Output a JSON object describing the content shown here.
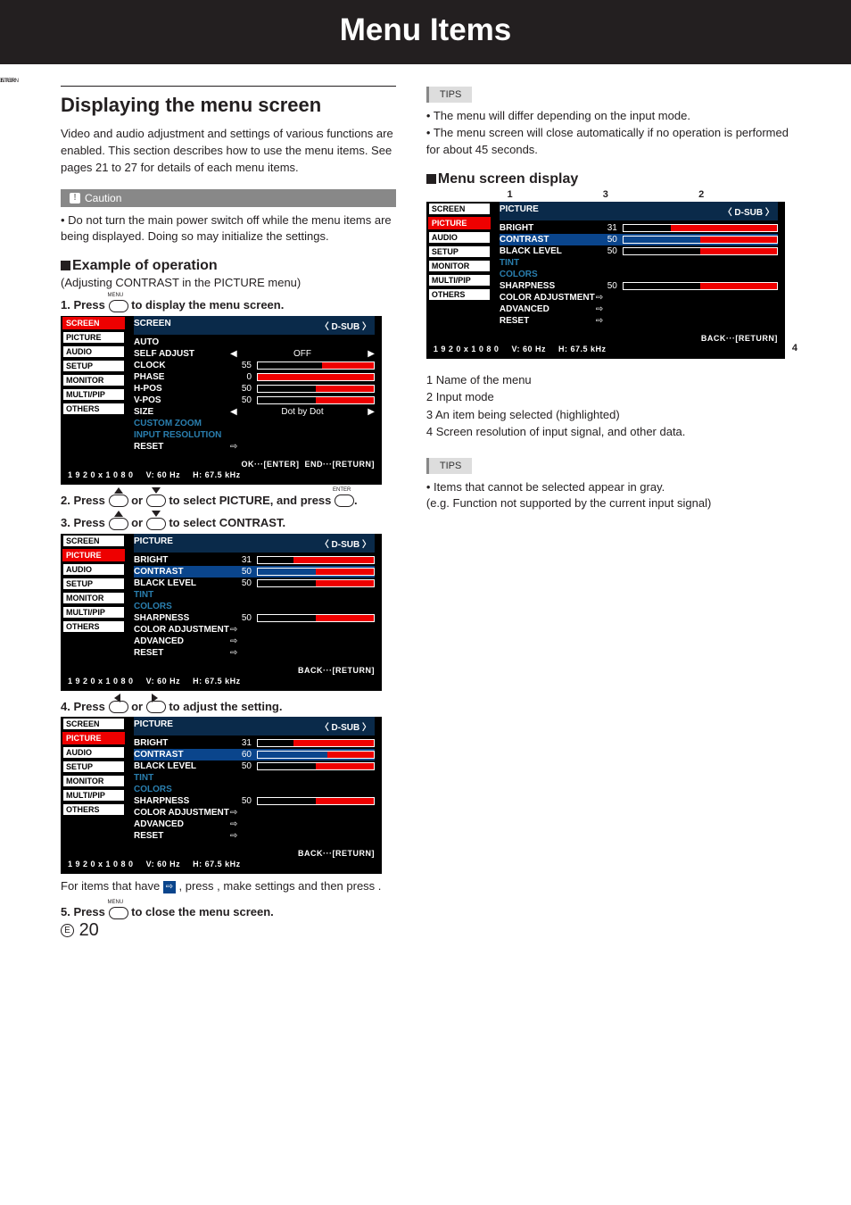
{
  "title": "Menu Items",
  "h_display": "Displaying the menu screen",
  "intro": "Video and audio adjustment and settings of various functions are enabled. This section describes how to use the menu items. See pages 21 to 27 for details of each menu items.",
  "caution_label": "Caution",
  "caution_text": "Do not turn the main power switch off while the menu items are being displayed. Doing so may initialize the settings.",
  "example_h": "Example of operation",
  "example_sub": "(Adjusting CONTRAST in the PICTURE menu)",
  "step1_a": "1.  Press ",
  "step1_b": " to display the menu screen.",
  "step2_a": "2.  Press ",
  "step2_or": " or ",
  "step2_b": " to select PICTURE, and press ",
  "step2_c": ".",
  "step3_a": "3.  Press ",
  "step3_b": " to select CONTRAST.",
  "step4_a": "4.  Press ",
  "step4_b": " to adjust the setting.",
  "after_osd_a": "For items that have ",
  "after_osd_b": " , press ",
  "after_osd_c": ", make settings and then press ",
  "after_osd_d": " .",
  "step5_a": "5.  Press ",
  "step5_b": " to close the menu screen.",
  "tips_label": "TIPS",
  "tips1": "The menu will differ depending on the input mode.",
  "tips2": "The menu screen will close automatically if no operation is performed for about 45 seconds.",
  "msd_h": "Menu screen display",
  "callouts": {
    "c1": "1",
    "c2": "2",
    "c3": "3",
    "c4": "4"
  },
  "legend1": "1   Name of the menu",
  "legend2": "2   Input mode",
  "legend3": "3   An item being selected (highlighted)",
  "legend4": "4   Screen resolution of input signal, and other data.",
  "tips3_a": "Items that cannot be selected appear in gray.",
  "tips3_b": "(e.g. Function not supported by the current input signal)",
  "page_num_e": "E",
  "page_num": "20",
  "osd": {
    "cats": [
      "SCREEN",
      "PICTURE",
      "AUDIO",
      "SETUP",
      "MONITOR",
      "MULTI/PIP",
      "OTHERS"
    ],
    "input_mode": "〈 D-SUB 〉",
    "foot_res": "1 9 2 0 x 1 0 8 0",
    "foot_v": "V: 60 Hz",
    "foot_h": "H: 67.5 kHz",
    "back": "BACK···[RETURN]",
    "okenter": "OK···[ENTER]",
    "endreturn": "END···[RETURN]",
    "screen_title": "SCREEN",
    "screen": {
      "auto": "AUTO",
      "self": "SELF ADJUST",
      "self_val": "OFF",
      "clock": "CLOCK",
      "clock_v": "55",
      "phase": "PHASE",
      "phase_v": "0",
      "hpos": "H-POS",
      "hpos_v": "50",
      "vpos": "V-POS",
      "vpos_v": "50",
      "size": "SIZE",
      "size_val": "Dot by Dot",
      "custom": "CUSTOM ZOOM",
      "ires": "INPUT RESOLUTION",
      "reset": "RESET"
    },
    "pic_title": "PICTURE",
    "pic": {
      "bright": "BRIGHT",
      "bright_v": "31",
      "contrast": "CONTRAST",
      "contrast_v1": "50",
      "contrast_v2": "60",
      "black": "BLACK LEVEL",
      "black_v": "50",
      "tint": "TINT",
      "colors": "COLORS",
      "sharp": "SHARPNESS",
      "sharp_v": "50",
      "coloradj": "COLOR ADJUSTMENT",
      "adv": "ADVANCED",
      "reset": "RESET"
    }
  }
}
